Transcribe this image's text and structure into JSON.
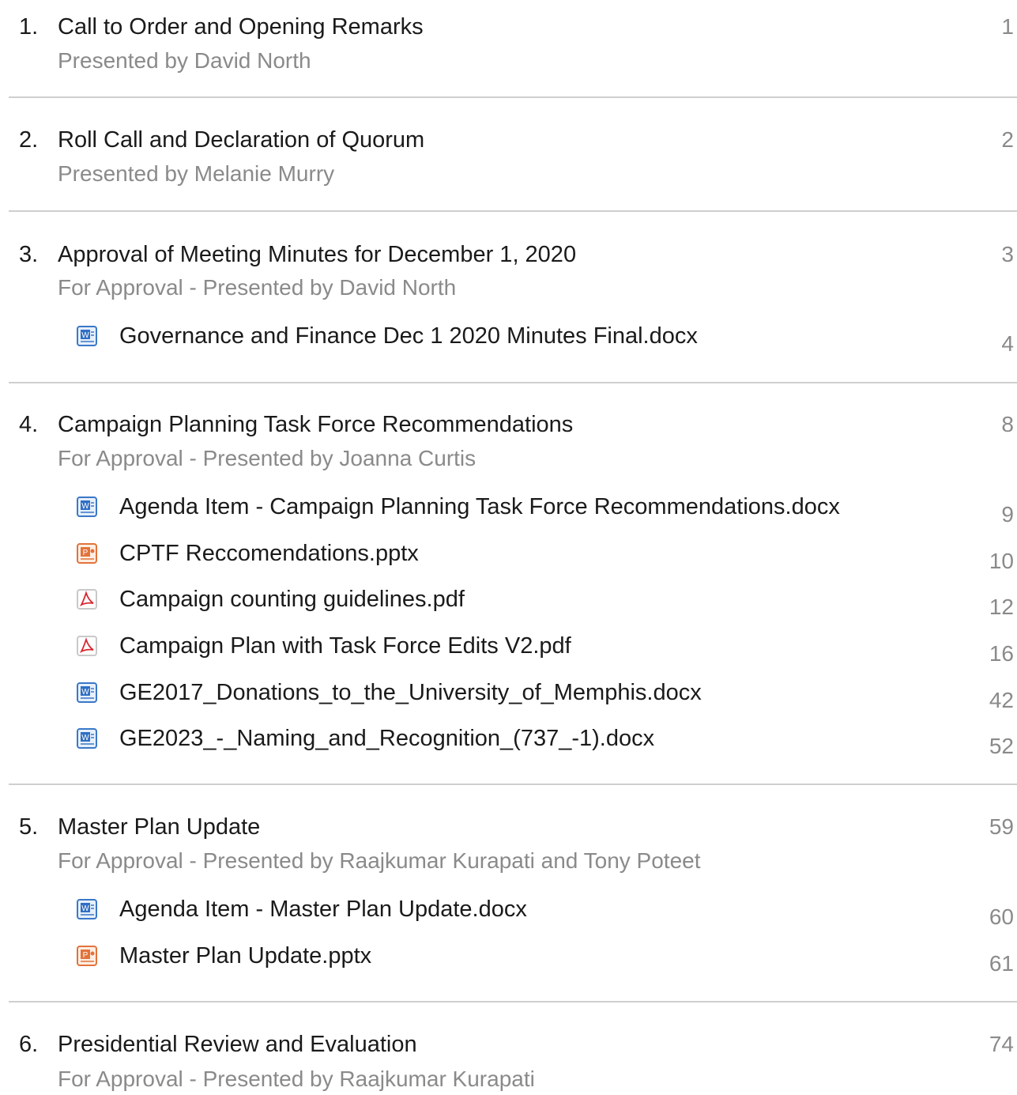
{
  "items": [
    {
      "num": "1.",
      "title": "Call to Order and Opening Remarks",
      "sub": "Presented by David North",
      "page": "1",
      "attachments": []
    },
    {
      "num": "2.",
      "title": "Roll Call and Declaration of Quorum",
      "sub": "Presented by Melanie Murry",
      "page": "2",
      "attachments": []
    },
    {
      "num": "3.",
      "title": "Approval of Meeting Minutes for December 1, 2020",
      "sub": "For Approval - Presented by David North",
      "page": "3",
      "attachments": [
        {
          "icon": "word-doc-icon",
          "name": "Governance and Finance Dec 1 2020 Minutes Final.docx",
          "page": "4"
        }
      ]
    },
    {
      "num": "4.",
      "title": "Campaign Planning Task Force Recommendations",
      "sub": "For Approval - Presented by Joanna Curtis",
      "page": "8",
      "attachments": [
        {
          "icon": "word-doc-icon",
          "name": "Agenda Item - Campaign Planning Task Force Recommendations.docx",
          "page": "9"
        },
        {
          "icon": "powerpoint-icon",
          "name": "CPTF Reccomendations.pptx",
          "page": "10"
        },
        {
          "icon": "pdf-icon",
          "name": "Campaign counting guidelines.pdf",
          "page": "12"
        },
        {
          "icon": "pdf-icon",
          "name": "Campaign Plan with Task Force Edits V2.pdf",
          "page": "16"
        },
        {
          "icon": "word-doc-icon",
          "name": "GE2017_Donations_to_the_University_of_Memphis.docx",
          "page": "42"
        },
        {
          "icon": "word-doc-icon",
          "name": "GE2023_-_Naming_and_Recognition_(737_-1).docx",
          "page": "52"
        }
      ]
    },
    {
      "num": "5.",
      "title": "Master Plan Update",
      "sub": "For Approval - Presented by Raajkumar Kurapati and Tony Poteet",
      "page": "59",
      "attachments": [
        {
          "icon": "word-doc-icon",
          "name": "Agenda Item - Master Plan Update.docx",
          "page": "60"
        },
        {
          "icon": "powerpoint-icon",
          "name": "Master Plan Update.pptx",
          "page": "61"
        }
      ]
    },
    {
      "num": "6.",
      "title": "Presidential Review and Evaluation",
      "sub": "For Approval - Presented by Raajkumar Kurapati",
      "page": "74",
      "attachments": []
    }
  ]
}
